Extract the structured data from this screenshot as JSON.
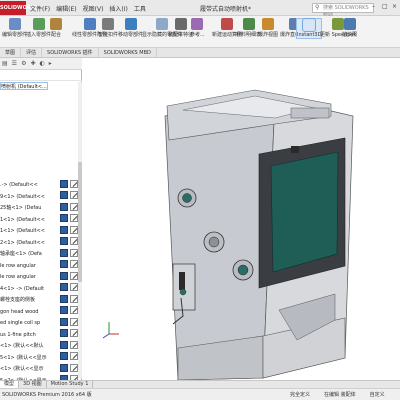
{
  "app": {
    "logo": "SOLIDWORKS",
    "document_title": "履带式自动喷射机*",
    "menu": [
      "文件(F)",
      "编辑(E)",
      "视图(V)",
      "插入(I)",
      "工具"
    ],
    "search_placeholder": "搜索 SOLIDWORKS 帮助"
  },
  "ribbon": {
    "buttons": [
      {
        "label": "编辑零部件",
        "color": "#6b8cc4"
      },
      {
        "label": "插入零部件",
        "color": "#5a9c5a"
      },
      {
        "label": "配合",
        "color": "#b0843c"
      },
      {
        "label": "线性零部件阵列",
        "color": "#4f7fbf"
      },
      {
        "label": "智能扣件",
        "color": "#7b7b7b"
      },
      {
        "label": "移动零部件",
        "color": "#3c7fc0"
      },
      {
        "label": "显示隐藏的零部件",
        "color": "#8fa7c9"
      },
      {
        "label": "装配体特征",
        "color": "#6a6a6a"
      },
      {
        "label": "参考...",
        "color": "#9a6bb0"
      },
      {
        "label": "新建运动算例",
        "color": "#c04a4a"
      },
      {
        "label": "材料明细表",
        "color": "#4c8a4c"
      },
      {
        "label": "爆炸视图",
        "color": "#c88a2c"
      },
      {
        "label": "爆炸直线草图",
        "color": "#5e7db0"
      },
      {
        "label": "Instant3D",
        "color": "#3d6fa8"
      },
      {
        "label": "更新 Speedpak",
        "color": "#7a9a3a"
      },
      {
        "label": "拍快照",
        "color": "#4a7ab0"
      }
    ],
    "active_label": "Instant3D"
  },
  "command_tabs": [
    "草图",
    "评估",
    "SOLIDWORKS 插件",
    "SOLIDWORKS MBD"
  ],
  "tree": {
    "root": "喷射机 (Default<...",
    "rows": [
      ".-> (Default<<",
      "9<1> (Default<<",
      "25轴<1> (Defau",
      "1<1> (Default<<",
      "1<1> (Default<<",
      "2<1> (Default<<",
      "轴承座<1> (Defa",
      "le row angular",
      "le row angular",
      "4<1> -> (Default",
      "螺栓支座的侧板",
      "gon head wood",
      "ed single coil sp",
      "us 1-fine pitch",
      "<1> (默认<<默认",
      "5<1> (默认<<显示",
      "<1> (默认<<显示",
      "5<2> (默认<<显示"
    ]
  },
  "bottom_tabs": [
    "模型",
    "3D 视图",
    "Motion Study 1"
  ],
  "status": {
    "left": "SOLIDWORKS Premium 2016 x64 版",
    "right": [
      "完全定义",
      "在编辑 装配体",
      "自定义"
    ]
  },
  "viewport": {
    "model": "履带式自动喷射机",
    "body_color": "#c9ccd1",
    "door_color": "#1f5e56"
  },
  "colors": {
    "accent": "#3d6fa8",
    "mate_icon": "#2f5e9e"
  }
}
